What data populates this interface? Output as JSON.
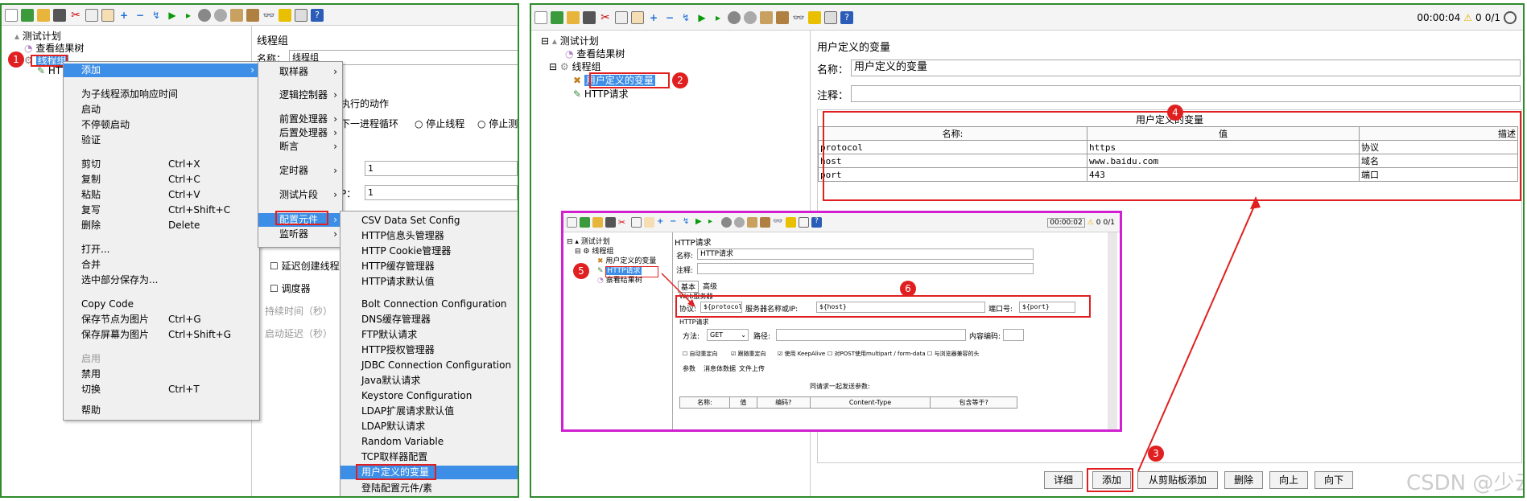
{
  "colors": {
    "panel_border": "#2e8b2e",
    "highlight": "#3d8ee6",
    "annotation": "#e02020",
    "inset_border": "#d020d0"
  },
  "left": {
    "tree": {
      "root": "测试计划",
      "results": "查看结果树",
      "group": "线程组",
      "http": "HTTP"
    },
    "right_panel": {
      "title": "线程组",
      "name_label": "名称：",
      "name_value": "线程组",
      "action_label": "执行的动作",
      "opt_next_loop": "下一进程循环",
      "opt_stop_thread": "停止线程",
      "opt_stop_test": "停止测",
      "field_1_value": "1",
      "field_2_label": "P：",
      "field_2_value": "1",
      "delay_create": "延迟创建线程",
      "scheduler": "调度器",
      "duration": "持续时间（秒）",
      "startup_delay": "启动延迟（秒）"
    },
    "context_menu": {
      "items": [
        {
          "label": "添加",
          "arrow": "›"
        },
        {
          "label": "为子线程添加响应时间"
        },
        {
          "label": "启动"
        },
        {
          "label": "不停顿启动"
        },
        {
          "label": "验证"
        },
        {
          "label": "剪切",
          "shortcut": "Ctrl+X"
        },
        {
          "label": "复制",
          "shortcut": "Ctrl+C"
        },
        {
          "label": "粘贴",
          "shortcut": "Ctrl+V"
        },
        {
          "label": "复写",
          "shortcut": "Ctrl+Shift+C"
        },
        {
          "label": "删除",
          "shortcut": "Delete"
        },
        {
          "label": "打开..."
        },
        {
          "label": "合并"
        },
        {
          "label": "选中部分保存为..."
        },
        {
          "label": "Copy Code"
        },
        {
          "label": "保存节点为图片",
          "shortcut": "Ctrl+G"
        },
        {
          "label": "保存屏幕为图片",
          "shortcut": "Ctrl+Shift+G"
        },
        {
          "label": "启用"
        },
        {
          "label": "禁用"
        },
        {
          "label": "切换",
          "shortcut": "Ctrl+T"
        },
        {
          "label": "帮助"
        }
      ]
    },
    "add_menu": {
      "items": [
        "取样器",
        "逻辑控制器",
        "前置处理器",
        "后置处理器",
        "断言",
        "定时器",
        "测试片段",
        "配置元件",
        "监听器"
      ]
    },
    "config_menu": {
      "items": [
        "CSV Data Set Config",
        "HTTP信息头管理器",
        "HTTP Cookie管理器",
        "HTTP缓存管理器",
        "HTTP请求默认值",
        "Bolt Connection Configuration",
        "DNS缓存管理器",
        "FTP默认请求",
        "HTTP授权管理器",
        "JDBC Connection Configuration",
        "Java默认请求",
        "Keystore Configuration",
        "LDAP扩展请求默认值",
        "LDAP默认请求",
        "Random Variable",
        "TCP取样器配置",
        "用户定义的变量",
        "登陆配置元件/素"
      ]
    }
  },
  "right": {
    "status": {
      "timer": "00:00:04",
      "warn_count": "0",
      "threads": "0/1"
    },
    "tree": {
      "root": "测试计划",
      "results": "查看结果树",
      "group": "线程组",
      "udv": "用户定义的变量",
      "http": "HTTP请求"
    },
    "form": {
      "title": "用户定义的变量",
      "name_label": "名称：",
      "name_value": "用户定义的变量",
      "comment_label": "注释：",
      "table_title": "用户定义的变量",
      "col_name": "名称:",
      "col_value": "值",
      "col_desc": "描述",
      "rows": [
        {
          "name": "protocol",
          "value": "https",
          "desc": "协议"
        },
        {
          "name": "host",
          "value": "www.baidu.com",
          "desc": "域名"
        },
        {
          "name": "port",
          "value": "443",
          "desc": "端口"
        }
      ]
    },
    "buttons": {
      "detail": "详细",
      "add": "添加",
      "paste": "从剪贴板添加",
      "delete": "删除",
      "up": "向上",
      "down": "向下"
    },
    "badges": {
      "b2": "2",
      "b3": "3",
      "b4": "4"
    },
    "watermark": "CSDN @少云清"
  },
  "inset": {
    "status": {
      "timer": "00:00:02",
      "warn_count": "0",
      "threads": "0/1"
    },
    "tree": {
      "root": "测试计划",
      "group": "线程组",
      "udv": "用户定义的变量",
      "http": "HTTP请求",
      "results": "察看结果树"
    },
    "form": {
      "title": "HTTP请求",
      "name_label": "名称:",
      "name_value": "HTTP请求",
      "comment_label": "注释:",
      "tab_basic": "基本",
      "tab_adv": "高级",
      "web_server": "Web服务器",
      "protocol_label": "协议:",
      "protocol_value": "${protocol}",
      "server_label": "服务器名称或IP:",
      "server_value": "${host}",
      "port_label": "端口号:",
      "port_value": "${port}",
      "http_req": "HTTP请求",
      "method_label": "方法:",
      "method_value": "GET",
      "path_label": "路径:",
      "encoding_label": "内容编码:",
      "cb_redirect_auto": "自动重定向",
      "cb_follow": "跟随重定向",
      "cb_keepalive": "使用 KeepAlive",
      "cb_multipart": "对POST使用multipart / form-data",
      "cb_browser": "与浏览器兼容的头",
      "tab_params": "参数",
      "tab_body": "消息体数据",
      "tab_upload": "文件上传",
      "send_params": "同请求一起发送参数:",
      "th_name": "名称:",
      "th_value": "值",
      "th_encode": "编码?",
      "th_ctype": "Content-Type",
      "th_include": "包含等于?"
    },
    "badges": {
      "b5": "5",
      "b6": "6"
    }
  },
  "badge1": "1"
}
